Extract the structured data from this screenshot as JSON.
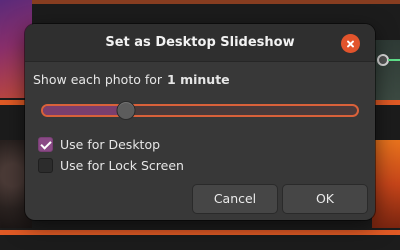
{
  "dialog": {
    "title": "Set as Desktop Slideshow",
    "close_icon": "close-icon",
    "show_label": "Show each photo for",
    "duration_value": "1 minute",
    "slider_fraction": 0.25,
    "checkboxes": [
      {
        "label": "Use for Desktop",
        "checked": true
      },
      {
        "label": "Use for Lock Screen",
        "checked": false
      }
    ],
    "buttons": {
      "cancel": "Cancel",
      "ok": "OK"
    }
  },
  "colors": {
    "accent": "#e2542c",
    "checkbox_checked": "#8a4a86",
    "slider_border": "#d9613a",
    "slider_fill": "#7a3f6e",
    "dialog_bg": "#383838"
  }
}
